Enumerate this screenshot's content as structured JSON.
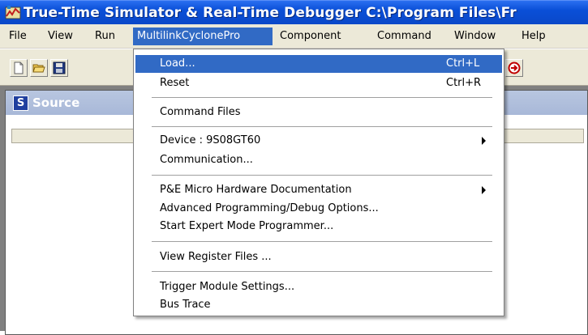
{
  "window": {
    "title": "True-Time Simulator & Real-Time Debugger  C:\\Program Files\\Fr"
  },
  "menubar": {
    "items": [
      {
        "label": "File"
      },
      {
        "label": "View"
      },
      {
        "label": "Run"
      },
      {
        "label": "MultilinkCyclonePro",
        "active": true
      },
      {
        "label": "Component"
      },
      {
        "label": "Command"
      },
      {
        "label": "Window"
      },
      {
        "label": "Help"
      }
    ]
  },
  "toolbar": {
    "buttons": [
      {
        "icon": "new-file-icon"
      },
      {
        "icon": "open-folder-icon"
      },
      {
        "icon": "save-floppy-icon"
      },
      {
        "icon": "halt-icon"
      }
    ]
  },
  "source_window": {
    "icon_letter": "S",
    "title": "Source"
  },
  "dropdown": {
    "items": [
      {
        "label": "Load...",
        "shortcut": "Ctrl+L",
        "highlighted": true
      },
      {
        "label": "Reset",
        "shortcut": "Ctrl+R"
      },
      {
        "label": "Command Files"
      },
      {
        "label": "Device : 9S08GT60",
        "submenu": true
      },
      {
        "label": "Communication..."
      },
      {
        "label": "P&E Micro Hardware Documentation",
        "submenu": true
      },
      {
        "label": "Advanced Programming/Debug Options..."
      },
      {
        "label": "Start Expert Mode Programmer..."
      },
      {
        "label": "View Register Files ..."
      },
      {
        "label": "Trigger Module Settings..."
      },
      {
        "label": "Bus Trace"
      }
    ]
  },
  "colors": {
    "titlebar": "#0a4fd8",
    "menu_highlight": "#316ac5",
    "chrome": "#ece9d8",
    "workspace": "#808080"
  }
}
